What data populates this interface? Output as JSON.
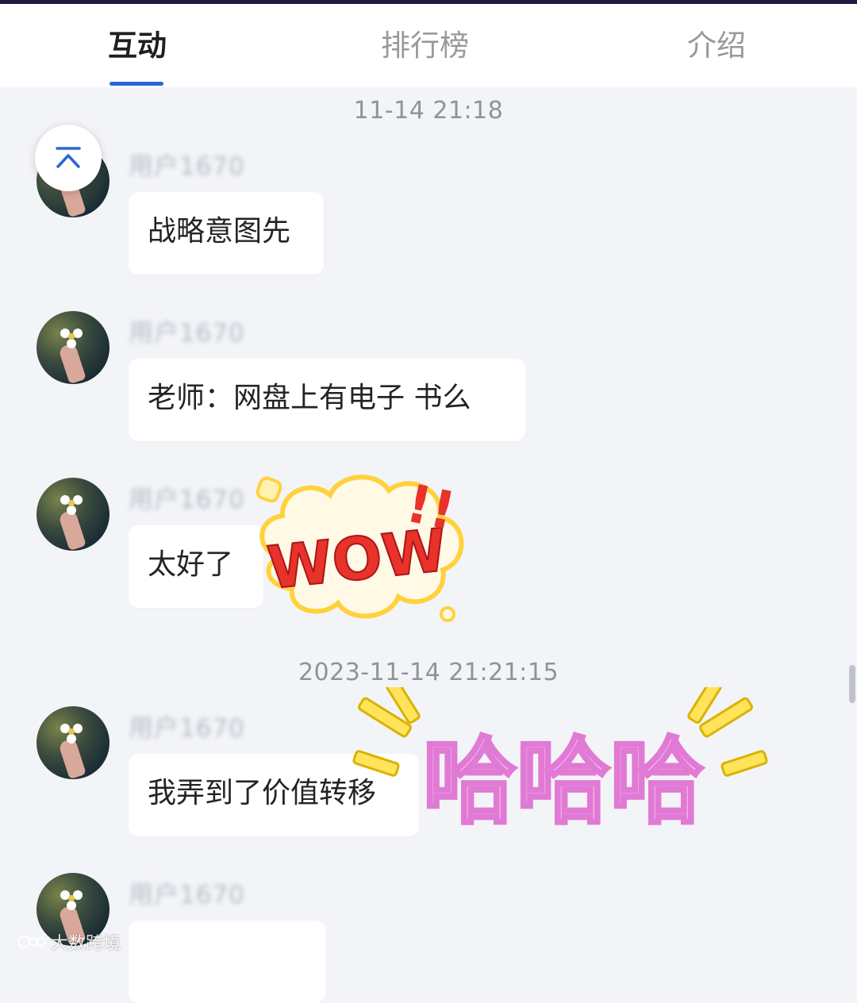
{
  "tabs": [
    {
      "label": "互动",
      "active": true
    },
    {
      "label": "排行榜",
      "active": false
    },
    {
      "label": "介绍",
      "active": false
    }
  ],
  "feed": {
    "timestamps": [
      "11-14 21:18",
      "2023-11-14 21:21:15"
    ],
    "messages": [
      {
        "user": "用户1670",
        "text": "战略意图先"
      },
      {
        "user": "用户1670",
        "text": "老师：网盘上有电子 书么"
      },
      {
        "user": "用户1670",
        "text": "太好了"
      },
      {
        "user": "用户1670",
        "text": "我弄到了价值转移"
      },
      {
        "user": "用户1670",
        "text": ""
      }
    ]
  },
  "stickers": {
    "wow": {
      "text": "WOW",
      "exclaim": "!!"
    },
    "haha": {
      "text": "哈哈哈"
    }
  },
  "watermark": {
    "text": "大数跨境",
    "logo": "100"
  },
  "colors": {
    "accent": "#2a66d9",
    "background": "#f3f4f8",
    "wow_red": "#e8322a",
    "wow_yellow": "#ffd23c",
    "haha_pink": "#f19be6"
  },
  "icons": {
    "scroll_top": "chevron-up-icon"
  }
}
